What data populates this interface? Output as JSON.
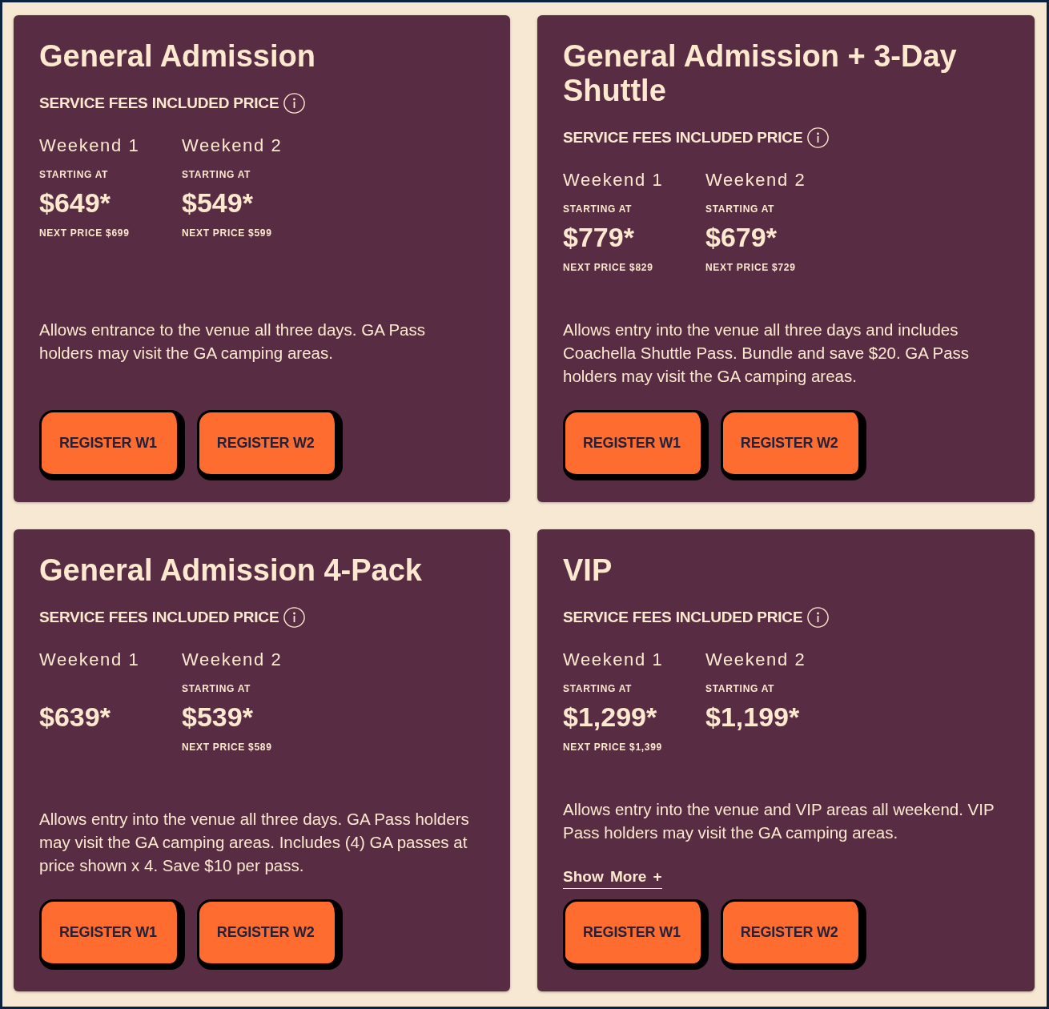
{
  "cards": [
    {
      "title": "General Admission",
      "price_note": "SERVICE FEES INCLUDED PRICE",
      "weekends": [
        {
          "label": "Weekend 1",
          "starting_label": "STARTING AT",
          "price": "$649*",
          "next_price": "NEXT PRICE $699"
        },
        {
          "label": "Weekend 2",
          "starting_label": "STARTING AT",
          "price": "$549*",
          "next_price": "NEXT PRICE $599"
        }
      ],
      "description": "Allows entrance to the venue all three days. GA Pass holders may visit the GA camping areas.",
      "buttons": [
        "REGISTER W1",
        "REGISTER W2"
      ]
    },
    {
      "title": "General Admission + 3-Day Shuttle",
      "price_note": "SERVICE FEES INCLUDED PRICE",
      "weekends": [
        {
          "label": "Weekend 1",
          "starting_label": "STARTING AT",
          "price": "$779*",
          "next_price": "NEXT PRICE $829"
        },
        {
          "label": "Weekend 2",
          "starting_label": "STARTING AT",
          "price": "$679*",
          "next_price": "NEXT PRICE $729"
        }
      ],
      "description": "Allows entry into the venue all three days and includes Coachella Shuttle Pass. Bundle and save $20. GA Pass holders may visit the GA camping areas.",
      "buttons": [
        "REGISTER W1",
        "REGISTER W2"
      ]
    },
    {
      "title": "General Admission 4-Pack",
      "price_note": "SERVICE FEES INCLUDED PRICE",
      "weekends": [
        {
          "label": "Weekend 1",
          "price": "$639*"
        },
        {
          "label": "Weekend 2",
          "starting_label": "STARTING AT",
          "price": "$539*",
          "next_price": "NEXT PRICE $589"
        }
      ],
      "description": "Allows entry into the venue all three days. GA Pass holders may visit the GA camping areas. Includes (4) GA passes at price shown x 4. Save $10 per pass.",
      "buttons": [
        "REGISTER W1",
        "REGISTER W2"
      ]
    },
    {
      "title": "VIP",
      "price_note": "SERVICE FEES INCLUDED PRICE",
      "weekends": [
        {
          "label": "Weekend 1",
          "starting_label": "STARTING AT",
          "price": "$1,299*",
          "next_price": "NEXT PRICE $1,399"
        },
        {
          "label": "Weekend 2",
          "starting_label": "STARTING AT",
          "price": "$1,199*"
        }
      ],
      "description": "Allows entry into the venue and VIP areas all weekend. VIP Pass holders may visit the GA camping areas.",
      "show_more": "Show More +",
      "buttons": [
        "REGISTER W1",
        "REGISTER W2"
      ]
    }
  ]
}
